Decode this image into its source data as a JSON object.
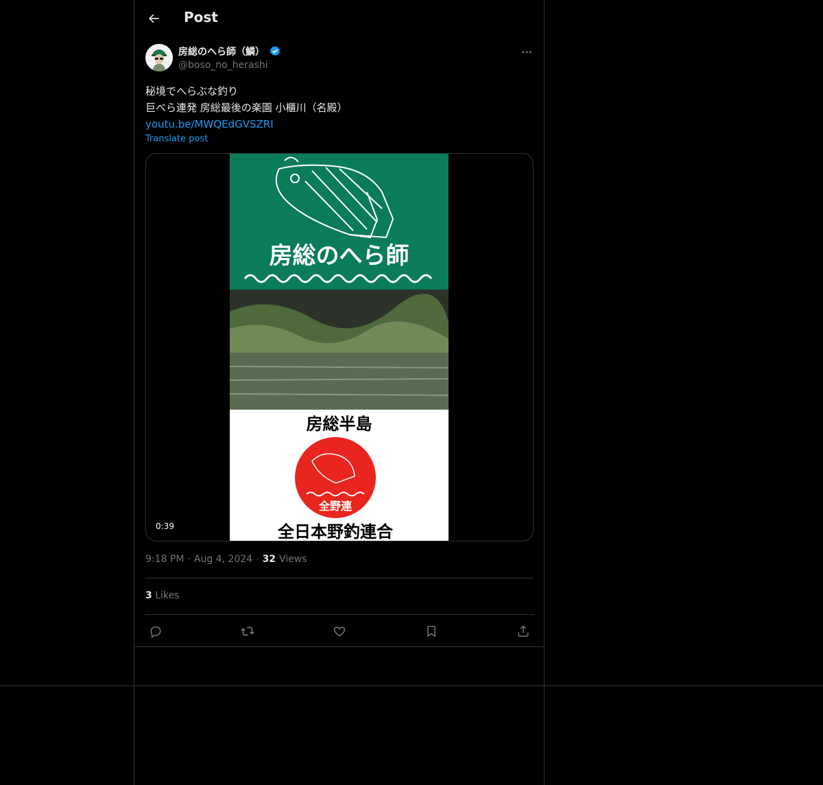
{
  "header": {
    "title": "Post"
  },
  "author": {
    "name": "房総のへら師（鱗）",
    "handle": "@boso_no_herashi",
    "verified": true
  },
  "post": {
    "line1": "秘境でへらぶな釣り",
    "line2": "巨べら連発 房総最後の楽園 小櫃川（名殿）",
    "link": "youtu.be/MWQEdGVSZRI",
    "translate": "Translate post"
  },
  "media": {
    "duration": "0:39",
    "banner_text": "房総のへら師",
    "region_text": "房総半島",
    "badge_text": "全野連",
    "footer_text": "全日本野釣連合"
  },
  "meta": {
    "time": "9:18 PM",
    "date": "Aug 4, 2024",
    "views_count": "32",
    "views_label": "Views"
  },
  "likes": {
    "count": "3",
    "label": "Likes"
  },
  "colors": {
    "accent": "#1d9bf0",
    "banner_green": "#0b7c5a",
    "badge_red": "#e8261f"
  }
}
